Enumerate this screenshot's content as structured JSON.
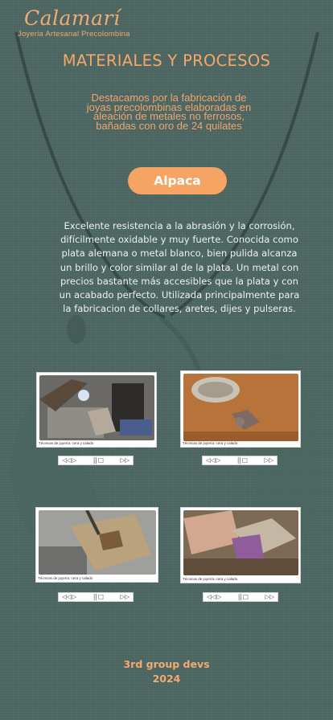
{
  "brand": {
    "title": "Calamarí",
    "subtitle": "Joyeria Artesanal Precolombina"
  },
  "page": {
    "title": "MATERIALES Y PROCESOS",
    "intro": "Destacamos por la fabricación de joyas precolombinas elaboradas en aleación de metales no ferrosos, bañadas con oro de 24 quilates"
  },
  "material": {
    "button_label": "Alpaca",
    "description": "Excelente resistencia a la abrasión y la corrosión, difícilmente oxidable y muy fuerte. Conocida como plata alemana o metal blanco, bien pulida alcanza un brillo y color similar al de la plata. Un metal con precios bastante más accesibles que la plata y con un acabado perfecto. Utilizada principalmente para la fabricacion de collares, aretes, dijes y pulseras."
  },
  "videos": [
    {
      "caption": "Técnicas de joyería: cera y calado",
      "controls": {
        "rewind": "◁◁",
        "play": "▷",
        "pause": "||",
        "stop": "□",
        "forward": "▷▷"
      }
    },
    {
      "caption": "Técnicas de joyería: cera y calado",
      "controls": {
        "rewind": "◁◁",
        "play": "▷",
        "pause": "||",
        "stop": "□",
        "forward": "▷▷"
      }
    },
    {
      "caption": "Técnicas de joyería: cera y calado",
      "controls": {
        "rewind": "◁◁",
        "play": "▷",
        "pause": "||",
        "stop": "□",
        "forward": "▷▷"
      }
    },
    {
      "caption": "Técnicas de joyería: cera y calado",
      "controls": {
        "rewind": "◁◁",
        "play": "▷",
        "pause": "||",
        "stop": "□",
        "forward": "▷▷"
      }
    }
  ],
  "footer": {
    "line1": "3rd group devs",
    "line2": "2024"
  },
  "colors": {
    "accent": "#f5a464",
    "background": "#4d6762",
    "text_light": "#eef1ee"
  }
}
